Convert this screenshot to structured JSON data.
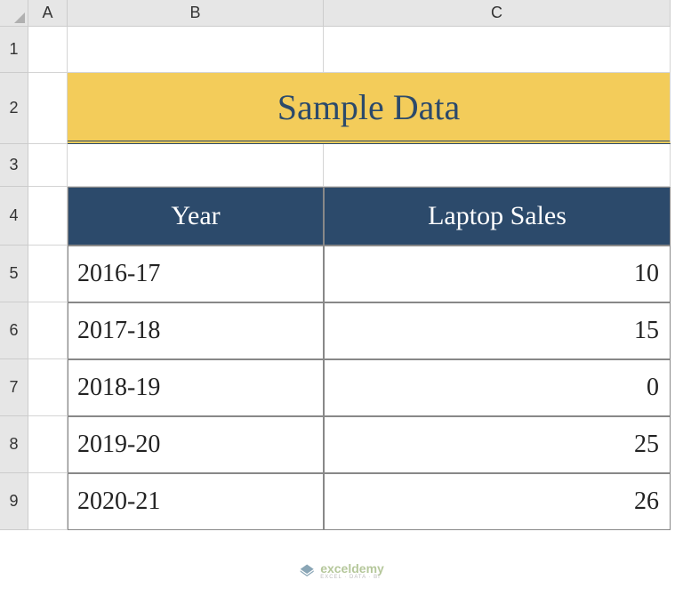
{
  "columns": [
    "A",
    "B",
    "C"
  ],
  "rows": [
    "1",
    "2",
    "3",
    "4",
    "5",
    "6",
    "7",
    "8",
    "9"
  ],
  "title": "Sample Data",
  "headers": {
    "year": "Year",
    "sales": "Laptop Sales"
  },
  "data": [
    {
      "year": "2016-17",
      "sales": "10"
    },
    {
      "year": "2017-18",
      "sales": "15"
    },
    {
      "year": "2018-19",
      "sales": "0"
    },
    {
      "year": "2019-20",
      "sales": "25"
    },
    {
      "year": "2020-21",
      "sales": "26"
    }
  ],
  "watermark": {
    "main": "exceldemy",
    "sub": "EXCEL · DATA · BI"
  },
  "chart_data": {
    "type": "table",
    "title": "Sample Data",
    "columns": [
      "Year",
      "Laptop Sales"
    ],
    "rows": [
      [
        "2016-17",
        10
      ],
      [
        "2017-18",
        15
      ],
      [
        "2018-19",
        0
      ],
      [
        "2019-20",
        25
      ],
      [
        "2020-21",
        26
      ]
    ]
  }
}
